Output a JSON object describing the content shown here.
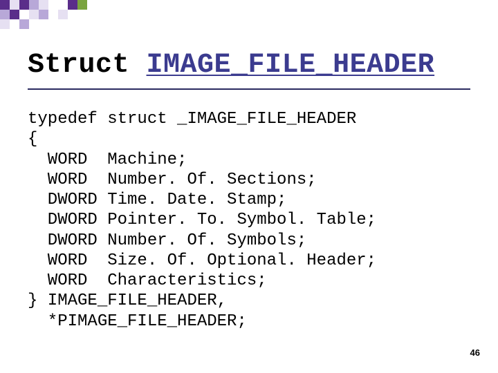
{
  "title": {
    "prefix": "Struct ",
    "underlined": "IMAGE_FILE_HEADER"
  },
  "code": {
    "line0": "typedef struct _IMAGE_FILE_HEADER",
    "line1": "{",
    "line2": "  WORD  Machine;",
    "line3": "  WORD  Number. Of. Sections;",
    "line4": "  DWORD Time. Date. Stamp;",
    "line5": "  DWORD Pointer. To. Symbol. Table;",
    "line6": "  DWORD Number. Of. Symbols;",
    "line7": "  WORD  Size. Of. Optional. Header;",
    "line8": "  WORD  Characteristics;",
    "line9": "} IMAGE_FILE_HEADER,",
    "line10": "  *PIMAGE_FILE_HEADER;"
  },
  "pagenum": "46",
  "decor": {
    "purple": "#5a2d8a",
    "lav": "#b8a8d8",
    "pale": "#e6e0f2",
    "green": "#7aa43f"
  }
}
